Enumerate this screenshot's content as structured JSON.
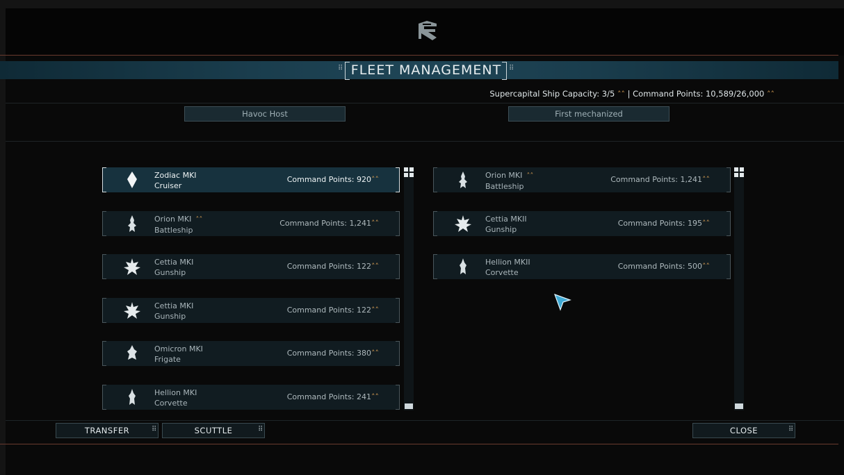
{
  "header": {
    "logo_icon": "faction-emblem-icon",
    "title": "FLEET MANAGEMENT",
    "capacity_label": "Supercapital Ship Capacity: 3/5",
    "separator": "|",
    "command_points_label": "Command Points: 10,589/26,000",
    "rank_glyph": "⌃"
  },
  "fleets": {
    "left_name": "Havoc Host",
    "right_name": "First mechanized"
  },
  "left_list": [
    {
      "name": "Zodiac MKI",
      "class": "Cruiser",
      "cp": "Command Points: 920",
      "icon": "cruiser-ship-icon",
      "selected": true,
      "supercapital": false
    },
    {
      "name": "Orion MKI",
      "class": "Battleship",
      "cp": "Command Points: 1,241",
      "icon": "battleship-ship-icon",
      "selected": false,
      "supercapital": true
    },
    {
      "name": "Cettia MKI",
      "class": "Gunship",
      "cp": "Command Points: 122",
      "icon": "gunship-ship-icon",
      "selected": false,
      "supercapital": false
    },
    {
      "name": "Cettia MKI",
      "class": "Gunship",
      "cp": "Command Points: 122",
      "icon": "gunship-ship-icon",
      "selected": false,
      "supercapital": false
    },
    {
      "name": "Omicron MKI",
      "class": "Frigate",
      "cp": "Command Points: 380",
      "icon": "frigate-ship-icon",
      "selected": false,
      "supercapital": false
    },
    {
      "name": "Hellion MKI",
      "class": "Corvette",
      "cp": "Command Points: 241",
      "icon": "corvette-ship-icon",
      "selected": false,
      "supercapital": false
    }
  ],
  "right_list": [
    {
      "name": "Orion MKI",
      "class": "Battleship",
      "cp": "Command Points: 1,241",
      "icon": "battleship-ship-icon",
      "selected": false,
      "supercapital": true
    },
    {
      "name": "Cettia MKII",
      "class": "Gunship",
      "cp": "Command Points: 195",
      "icon": "gunship-ship-icon",
      "selected": false,
      "supercapital": false
    },
    {
      "name": "Hellion MKII",
      "class": "Corvette",
      "cp": "Command Points: 500",
      "icon": "corvette-ship-icon",
      "selected": false,
      "supercapital": false
    }
  ],
  "buttons": {
    "transfer": "TRANSFER",
    "scuttle": "SCUTTLE",
    "close": "CLOSE"
  },
  "colors": {
    "accent_gold": "#d29a52",
    "title_bar": "#1f4556",
    "selected_row": "#17323e"
  }
}
